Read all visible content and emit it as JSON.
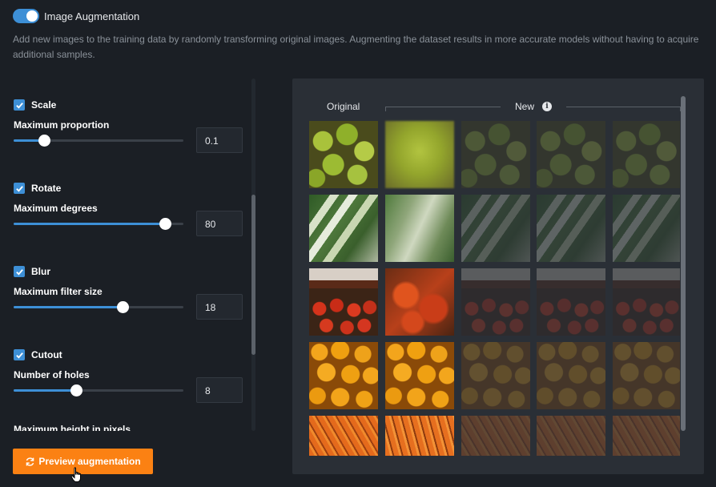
{
  "header": {
    "toggle_label": "Image Augmentation",
    "description": "Add new images to the training data by randomly transforming original images. Augmenting the dataset results in more accurate models without having to acquire additional samples."
  },
  "settings": [
    {
      "name": "Scale",
      "param_label": "Maximum proportion",
      "value": "0.1",
      "slider_fraction": 0.18,
      "checked": true
    },
    {
      "name": "Rotate",
      "param_label": "Maximum degrees",
      "value": "80",
      "slider_fraction": 0.89,
      "checked": true
    },
    {
      "name": "Blur",
      "param_label": "Maximum filter size",
      "value": "18",
      "slider_fraction": 0.64,
      "checked": true
    },
    {
      "name": "Cutout",
      "param_label": "Number of holes",
      "value": "8",
      "slider_fraction": 0.37,
      "checked": true
    }
  ],
  "cutout_extra_label": "Maximum height in pixels",
  "preview_button": {
    "label": "Preview augmentation",
    "icon": "refresh-icon"
  },
  "preview": {
    "original_label": "Original",
    "new_label": "New",
    "info_icon": "info-icon",
    "rows": [
      {
        "subject": "green apples"
      },
      {
        "subject": "leeks"
      },
      {
        "subject": "tomatoes"
      },
      {
        "subject": "oranges"
      },
      {
        "subject": "carrots"
      }
    ]
  },
  "colors": {
    "accent": "#3d8fd6",
    "button": "#fb8113",
    "background": "#1b1f25",
    "panel": "#2a2f36"
  }
}
